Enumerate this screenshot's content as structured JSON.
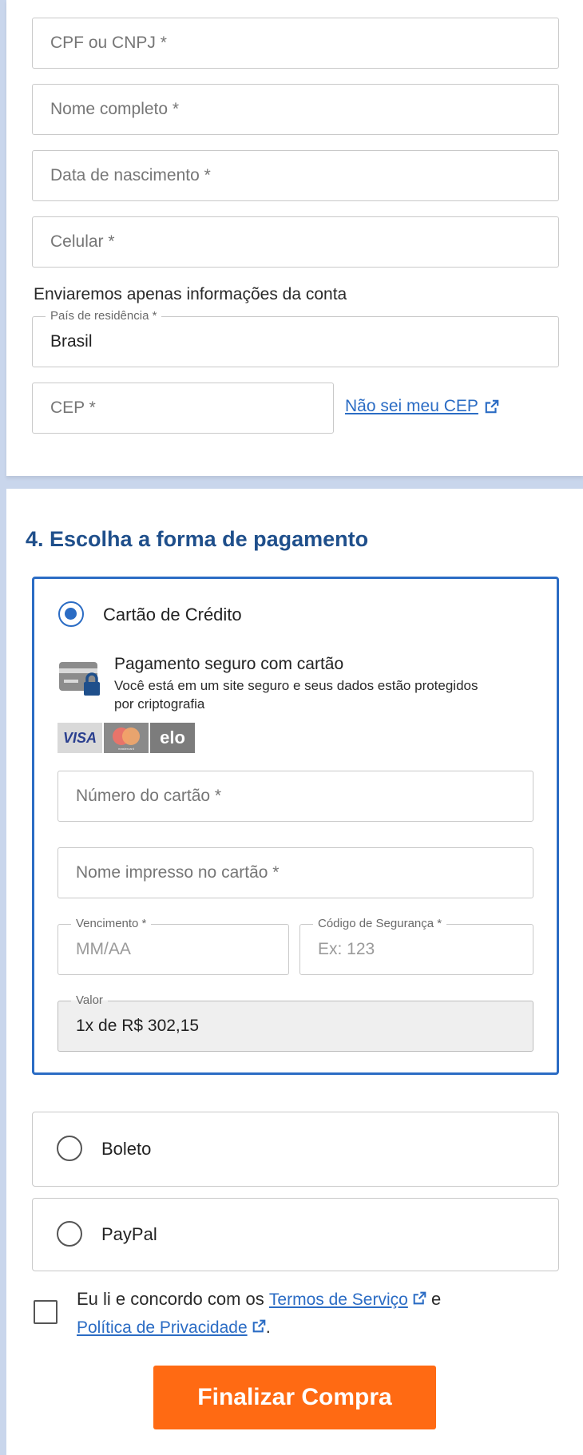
{
  "personal": {
    "cpf_placeholder": "CPF ou CNPJ *",
    "name_placeholder": "Nome completo *",
    "birth_placeholder": "Data de nascimento *",
    "phone_placeholder": "Celular *",
    "phone_helper": "Enviaremos apenas informações da conta",
    "country_label": "País de residência *",
    "country_value": "Brasil",
    "cep_placeholder": "CEP *",
    "cep_link": "Não sei meu CEP"
  },
  "payment": {
    "section_title": "4. Escolha a forma de pagamento",
    "options": [
      {
        "label": "Cartão de Crédito",
        "selected": true
      },
      {
        "label": "Boleto",
        "selected": false
      },
      {
        "label": "PayPal",
        "selected": false
      }
    ],
    "secure_title": "Pagamento seguro com cartão",
    "secure_desc": "Você está em um site seguro e seus dados estão protegidos por criptografia",
    "brands": [
      "VISA",
      "mastercard",
      "elo"
    ],
    "card_number_placeholder": "Número do cartão *",
    "card_name_placeholder": "Nome impresso no cartão *",
    "expiry_label": "Vencimento *",
    "expiry_placeholder": "MM/AA",
    "cvv_label": "Código de Segurança *",
    "cvv_placeholder": "Ex: 123",
    "amount_label": "Valor",
    "amount_value": "1x de R$ 302,15"
  },
  "terms": {
    "prefix": "Eu li e concordo com os ",
    "terms_link": "Termos de Serviço",
    "middle": " e",
    "privacy_link": "Política de Privacidade",
    "suffix": "."
  },
  "submit_label": "Finalizar Compra",
  "colors": {
    "accent": "#2b6cc4",
    "title": "#1f4f8b",
    "cta": "#ff6a13"
  }
}
